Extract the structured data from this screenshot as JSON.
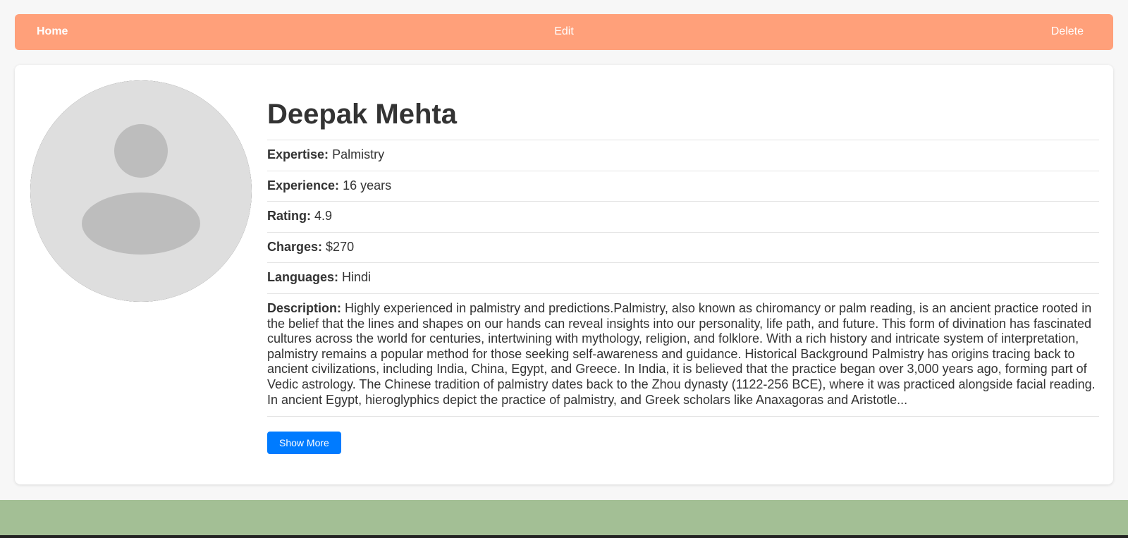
{
  "nav": {
    "home": "Home",
    "edit": "Edit",
    "delete": "Delete"
  },
  "colors": {
    "navbar": "#ffa07a",
    "button": "#007bff",
    "footer": "#a3bf95"
  },
  "avatar": {
    "icon": "user-placeholder-icon"
  },
  "profile": {
    "name": "Deepak Mehta",
    "fields": [
      {
        "label": "Expertise:",
        "value": "Palmistry"
      },
      {
        "label": "Experience:",
        "value": "16 years"
      },
      {
        "label": "Rating:",
        "value": "4.9"
      },
      {
        "label": "Charges:",
        "value": "$270"
      },
      {
        "label": "Languages:",
        "value": "Hindi"
      }
    ],
    "description_label": "Description:",
    "description": "Highly experienced in palmistry and predictions.Palmistry, also known as chiromancy or palm reading, is an ancient practice rooted in the belief that the lines and shapes on our hands can reveal insights into our personality, life path, and future. This form of divination has fascinated cultures across the world for centuries, intertwining with mythology, religion, and folklore. With a rich history and intricate system of interpretation, palmistry remains a popular method for those seeking self-awareness and guidance. Historical Background Palmistry has origins tracing back to ancient civilizations, including India, China, Egypt, and Greece. In India, it is believed that the practice began over 3,000 years ago, forming part of Vedic astrology. The Chinese tradition of palmistry dates back to the Zhou dynasty (1122-256 BCE), where it was practiced alongside facial reading. In ancient Egypt, hieroglyphics depict the practice of palmistry, and Greek scholars like Anaxagoras and Aristotle...",
    "show_more": "Show More"
  }
}
